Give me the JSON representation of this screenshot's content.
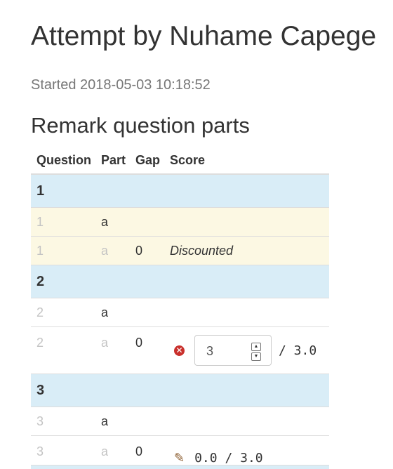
{
  "page": {
    "title": "Attempt by Nuhame Capege",
    "started": "Started 2018-05-03 10:18:52",
    "section_title": "Remark question parts"
  },
  "table": {
    "headers": [
      "Question",
      "Part",
      "Gap",
      "Score"
    ],
    "rows": [
      {
        "type": "question",
        "question": "1"
      },
      {
        "type": "part",
        "question": "1",
        "part": "a",
        "gap": "",
        "score": ""
      },
      {
        "type": "gap",
        "question": "1",
        "part": "a",
        "gap": "0",
        "score": "Discounted"
      },
      {
        "type": "question",
        "question": "2"
      },
      {
        "type": "part",
        "question": "2",
        "part": "a",
        "gap": "",
        "score": ""
      },
      {
        "type": "gap",
        "question": "2",
        "part": "a",
        "gap": "0",
        "score_input": "3",
        "score_max": "/ 3.0"
      },
      {
        "type": "question",
        "question": "3"
      },
      {
        "type": "part",
        "question": "3",
        "part": "a",
        "gap": "",
        "score": ""
      },
      {
        "type": "gap",
        "question": "3",
        "part": "a",
        "gap": "0",
        "score_text": "0.0 / 3.0"
      }
    ]
  },
  "icons": {
    "remove": "close-circle-icon",
    "edit": "pencil-icon"
  },
  "colors": {
    "question_row": "#d9edf7",
    "warning_row": "#fcf8e3",
    "remove_icon": "#c9302c",
    "edit_icon": "#8a5a2b"
  }
}
